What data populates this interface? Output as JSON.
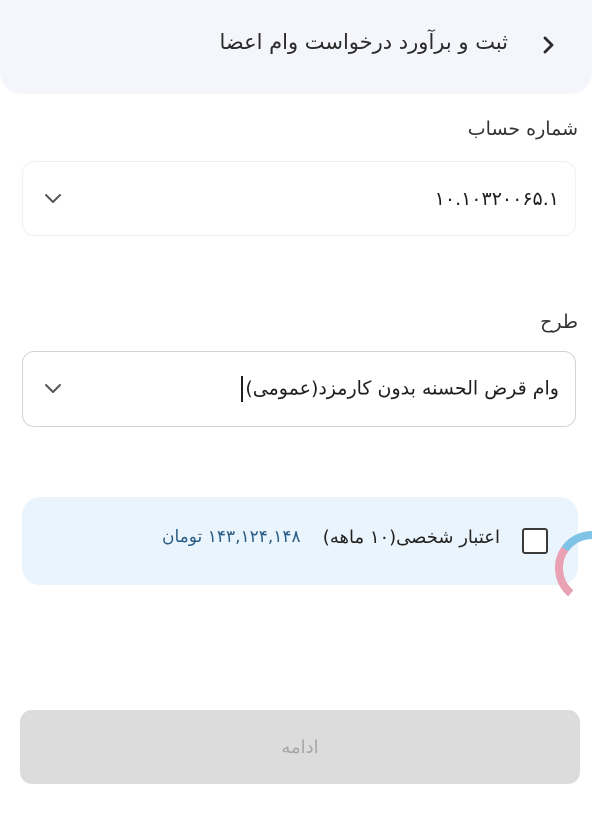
{
  "header": {
    "title": "ثبت و برآورد درخواست وام اعضا",
    "back_icon": "chevron-right-icon"
  },
  "account": {
    "label": "شماره حساب",
    "value": "۱۰.۱۰۳۲۰۰۶۵.۱",
    "dropdown_icon": "chevron-down-icon"
  },
  "plan": {
    "label": "طرح",
    "value": "وام قرض الحسنه بدون کارمزد(عمومی)",
    "dropdown_icon": "chevron-down-icon"
  },
  "credit": {
    "label": "اعتبار شخصی(۱۰ ماهه)",
    "amount": "۱۴۳,۱۲۴,۱۴۸ تومان",
    "checked": false
  },
  "actions": {
    "continue_label": "ادامه"
  },
  "colors": {
    "header_bg": "#f4f6fb",
    "card_bg": "#eaf4fc",
    "amount_text": "#2b5d86",
    "button_disabled_bg": "#dcdcdc",
    "button_disabled_text": "#a7a7a7",
    "spinner_pink": "#e9a2b4",
    "spinner_blue": "#7fc3e6"
  }
}
